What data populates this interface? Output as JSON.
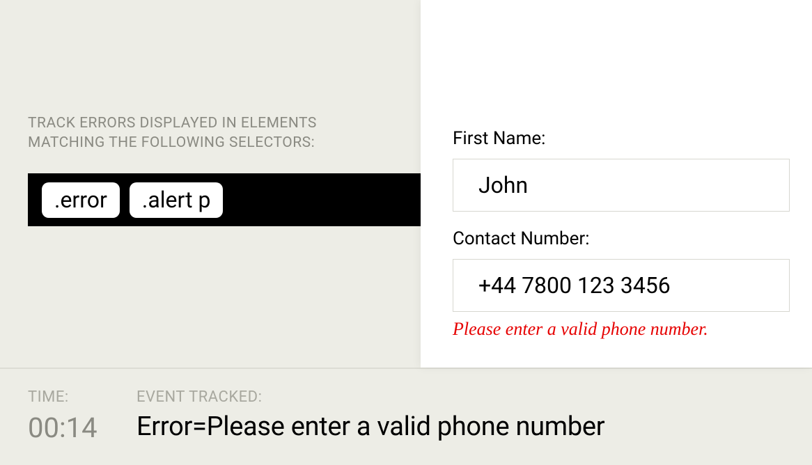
{
  "left": {
    "label": "TRACK ERRORS DISPLAYED IN ELEMENTS MATCHING THE FOLLOWING SELECTORS:",
    "selectors": [
      ".error",
      ".alert p"
    ]
  },
  "form": {
    "first_name_label": "First Name:",
    "first_name_value": "John",
    "contact_label": "Contact Number:",
    "contact_value": "+44 7800 123 3456",
    "error_message": "Please enter a valid phone number."
  },
  "bottom": {
    "time_label": "TIME:",
    "time_value": "00:14",
    "event_label": "EVENT TRACKED:",
    "event_value": "Error=Please enter a valid phone number"
  }
}
